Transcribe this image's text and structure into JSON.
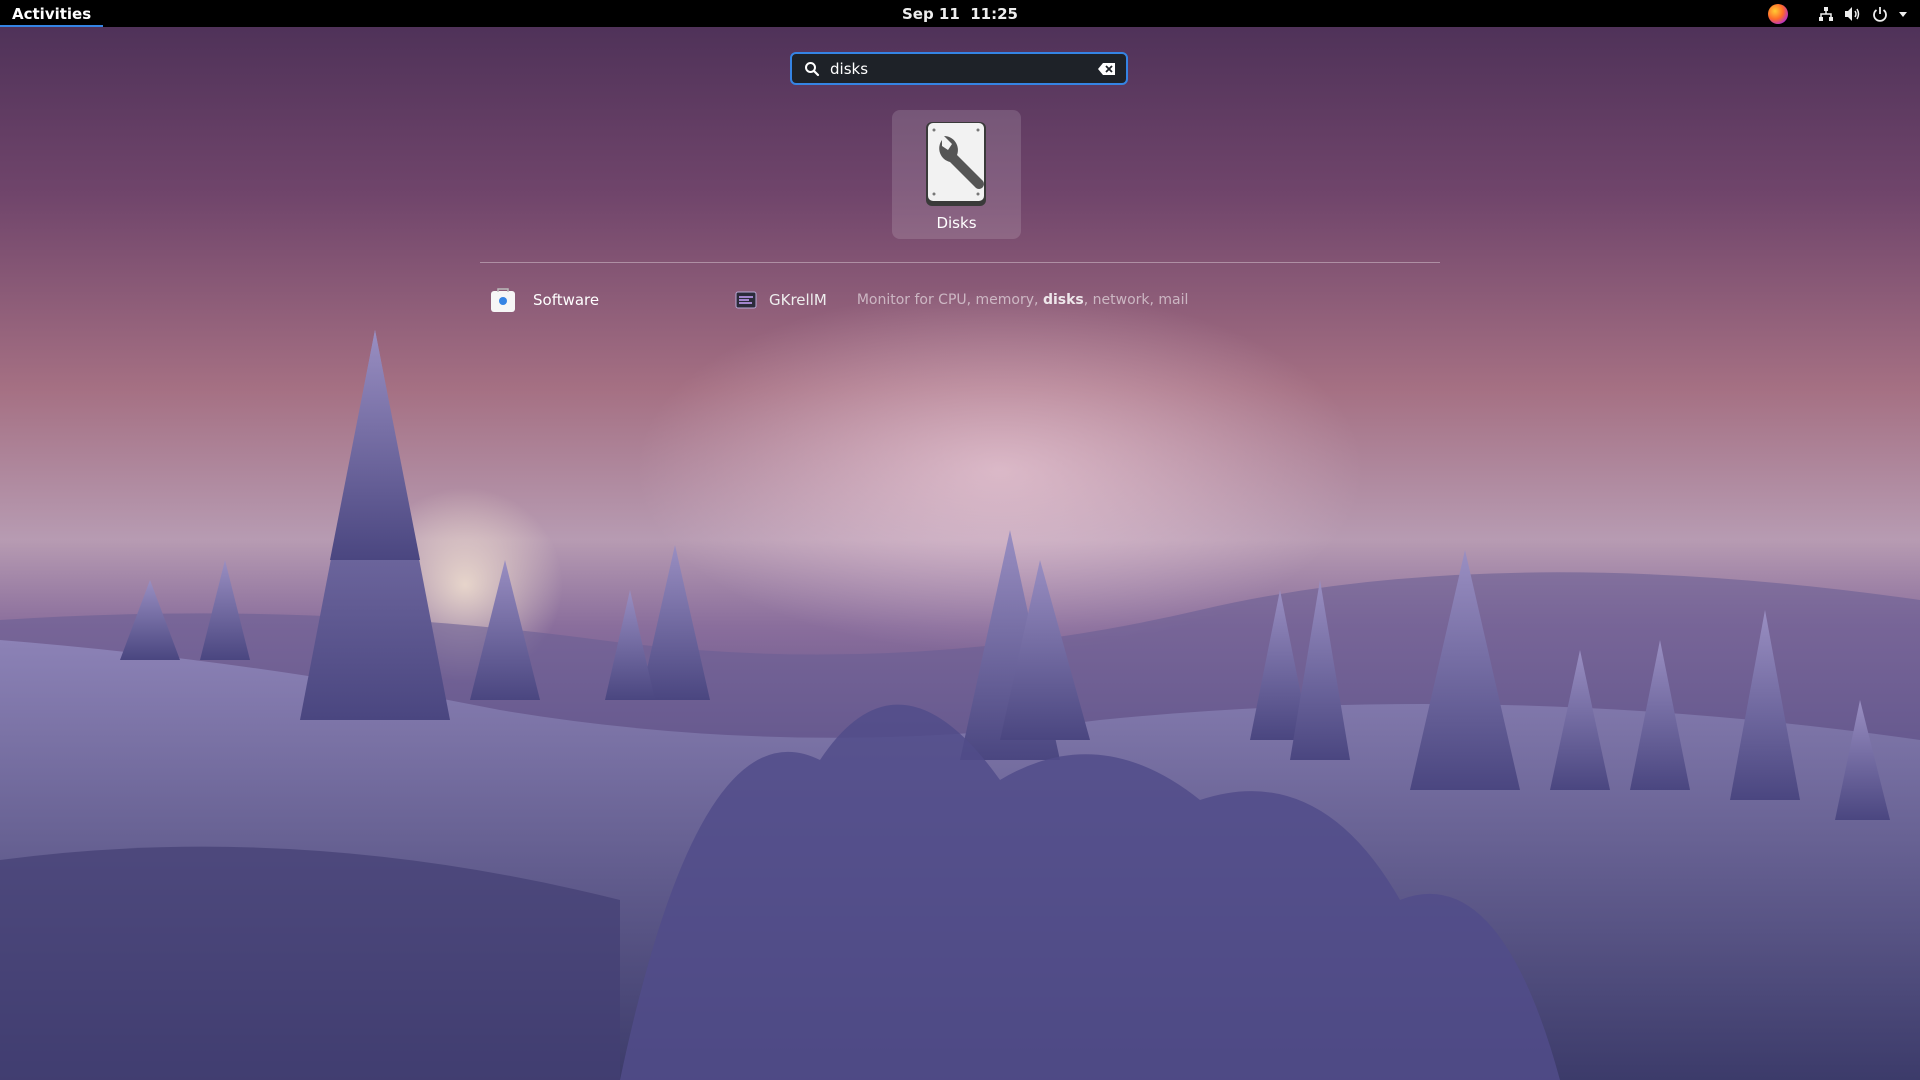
{
  "topbar": {
    "activities_label": "Activities",
    "clock": "Sep 11  11:25",
    "tray_icons": [
      "firefox-icon",
      "network-icon",
      "volume-icon",
      "power-icon",
      "menu-arrow-icon"
    ]
  },
  "search": {
    "value": "disks",
    "icon": "search-icon",
    "clear_icon": "clear-text-icon"
  },
  "app_results": [
    {
      "name": "Disks",
      "icon": "disks-icon"
    }
  ],
  "provider_results": {
    "software": {
      "label": "Software",
      "icon": "software-icon"
    },
    "gkrellm": {
      "title": "GKrellM",
      "desc_prefix": "Monitor for CPU, memory, ",
      "desc_match": "disks",
      "desc_suffix": ", network, mail",
      "icon": "gkrellm-icon"
    }
  },
  "colors": {
    "accent": "#3584e4",
    "topbar": "#000000",
    "search_bg": "#1e2228"
  }
}
